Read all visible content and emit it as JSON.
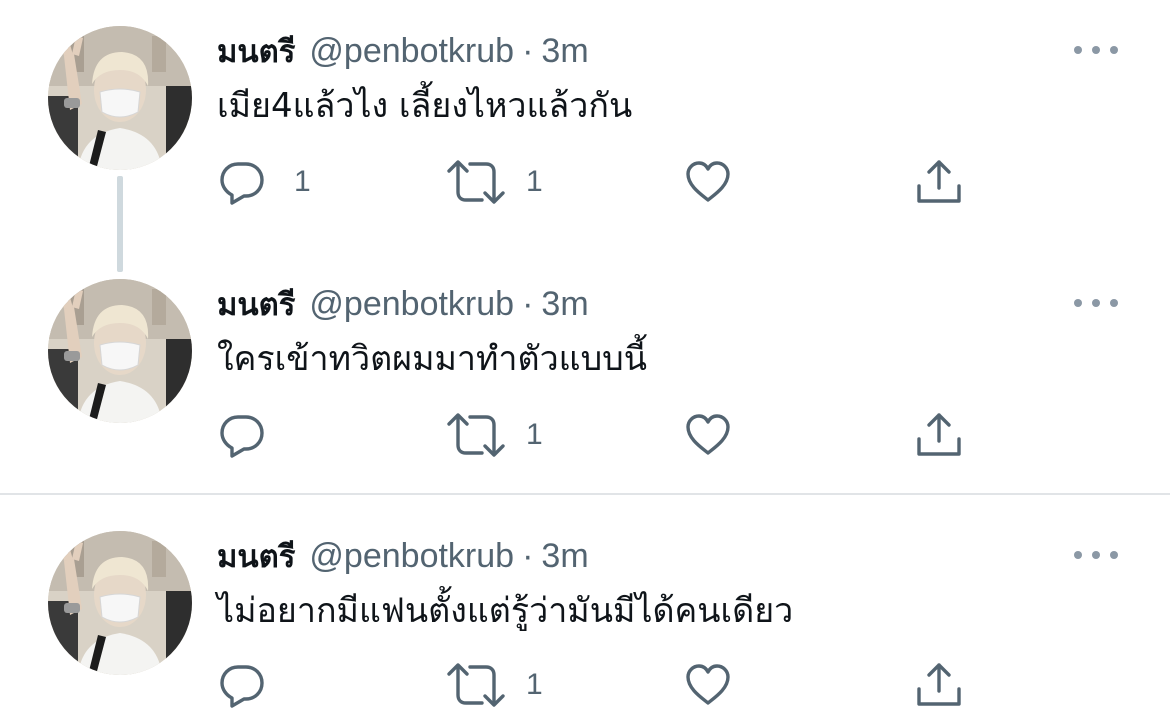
{
  "tweets": [
    {
      "name": "มนตรี",
      "handle": "@penbotkrub",
      "separator": "·",
      "time": "3m",
      "text": "เมีย4แล้วไง เลี้ยงไหวแล้วกัน",
      "reply_count": "1",
      "retweet_count": "1",
      "like_count": ""
    },
    {
      "name": "มนตรี",
      "handle": "@penbotkrub",
      "separator": "·",
      "time": "3m",
      "text": "ใครเข้าทวิตผมมาทำตัวแบบนี้",
      "reply_count": "",
      "retweet_count": "1",
      "like_count": ""
    },
    {
      "name": "มนตรี",
      "handle": "@penbotkrub",
      "separator": "·",
      "time": "3m",
      "text": "ไม่อยากมีแฟนตั้งแต่รู้ว่ามันมีได้คนเดียว",
      "reply_count": "",
      "retweet_count": "1",
      "like_count": ""
    }
  ],
  "icons": {
    "more": "more-horizontal-icon",
    "reply": "reply-bubble-icon",
    "retweet": "retweet-icon",
    "like": "heart-icon",
    "share": "share-upload-icon"
  },
  "colors": {
    "text_primary": "#0f1419",
    "text_secondary": "#536471",
    "thread_line": "#cfd9de",
    "divider": "#e1e4e7",
    "background": "#ffffff"
  }
}
